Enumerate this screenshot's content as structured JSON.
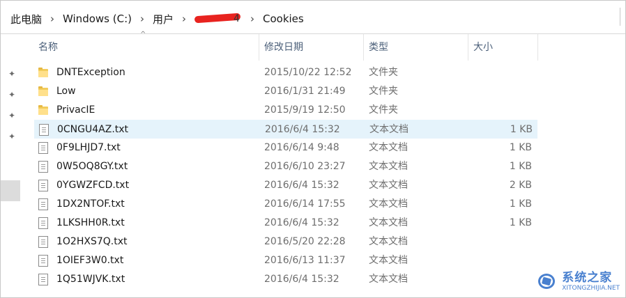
{
  "breadcrumb": {
    "items": [
      "此电脑",
      "Windows (C:)",
      "用户",
      "Cookies"
    ],
    "redacted_user_suffix": "4",
    "separator": "›"
  },
  "columns": {
    "name": "名称",
    "modified": "修改日期",
    "type": "类型",
    "size": "大小"
  },
  "sort_arrow": "^",
  "pins": [
    "pin-icon",
    "pin-icon",
    "pin-icon",
    "pin-icon"
  ],
  "files": [
    {
      "icon": "folder-icon",
      "name": "DNTException",
      "modified": "2015/10/22 12:52",
      "type": "文件夹",
      "size": ""
    },
    {
      "icon": "folder-icon",
      "name": "Low",
      "modified": "2016/1/31 21:49",
      "type": "文件夹",
      "size": ""
    },
    {
      "icon": "folder-icon",
      "name": "PrivacIE",
      "modified": "2015/9/19 12:50",
      "type": "文件夹",
      "size": ""
    },
    {
      "icon": "text-file-icon",
      "name": "0CNGU4AZ.txt",
      "modified": "2016/6/4 15:32",
      "type": "文本文档",
      "size": "1 KB",
      "selected": true
    },
    {
      "icon": "text-file-icon",
      "name": "0F9LHJD7.txt",
      "modified": "2016/6/14 9:48",
      "type": "文本文档",
      "size": "1 KB"
    },
    {
      "icon": "text-file-icon",
      "name": "0W5OQ8GY.txt",
      "modified": "2016/6/10 23:27",
      "type": "文本文档",
      "size": "1 KB"
    },
    {
      "icon": "text-file-icon",
      "name": "0YGWZFCD.txt",
      "modified": "2016/6/4 15:32",
      "type": "文本文档",
      "size": "2 KB"
    },
    {
      "icon": "text-file-icon",
      "name": "1DX2NTOF.txt",
      "modified": "2016/6/14 17:55",
      "type": "文本文档",
      "size": "1 KB"
    },
    {
      "icon": "text-file-icon",
      "name": "1LKSHH0R.txt",
      "modified": "2016/6/4 15:32",
      "type": "文本文档",
      "size": "1 KB"
    },
    {
      "icon": "text-file-icon",
      "name": "1O2HXS7Q.txt",
      "modified": "2016/5/20 22:28",
      "type": "文本文档",
      "size": ""
    },
    {
      "icon": "text-file-icon",
      "name": "1OIEF3W0.txt",
      "modified": "2016/6/13 11:37",
      "type": "文本文档",
      "size": ""
    },
    {
      "icon": "text-file-icon",
      "name": "1Q51WJVK.txt",
      "modified": "2016/6/4 15:32",
      "type": "文本文档",
      "size": ""
    }
  ],
  "watermark": {
    "main": "系统之家",
    "sub": "XITONGZHIJIA.NET"
  },
  "colors": {
    "header_text": "#4c607a",
    "selected_row": "#e5f3fb",
    "folder": "#f2cc5b",
    "redaction": "#e8231f",
    "watermark": "#2a6bc7"
  }
}
